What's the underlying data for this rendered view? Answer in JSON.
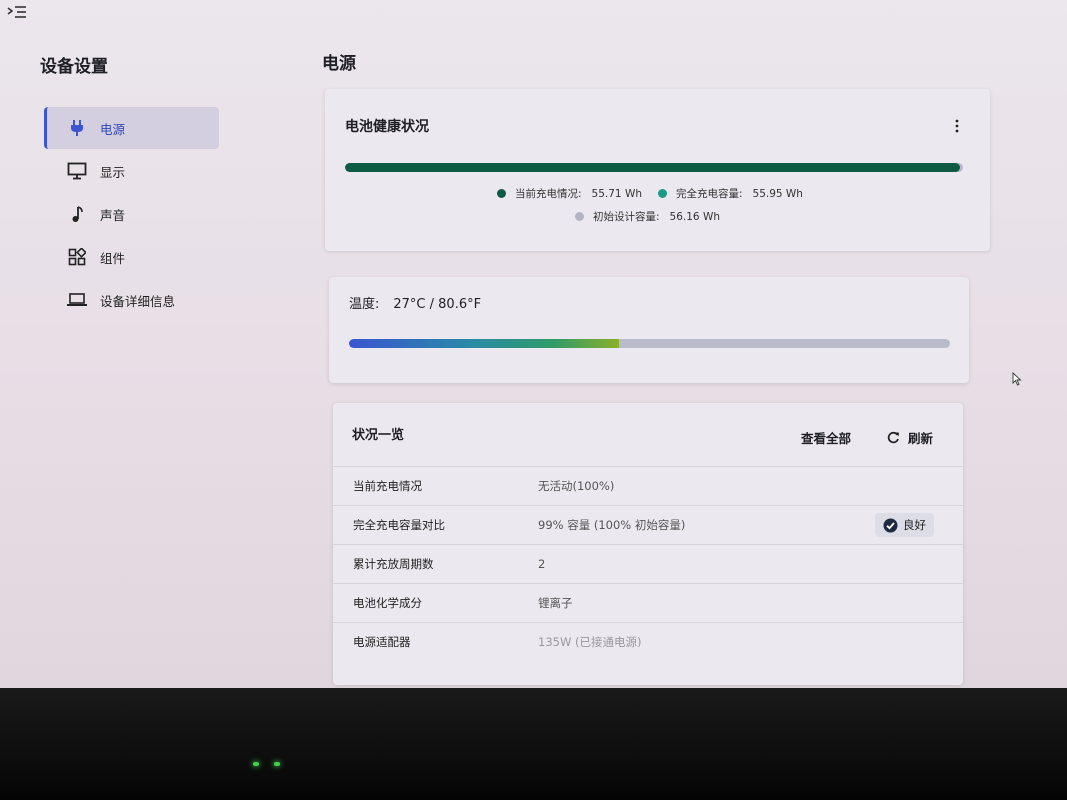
{
  "sidebar": {
    "title": "设备设置",
    "items": [
      {
        "label": "电源",
        "icon": "plug-icon",
        "active": true
      },
      {
        "label": "显示",
        "icon": "monitor-icon",
        "active": false
      },
      {
        "label": "声音",
        "icon": "music-note-icon",
        "active": false
      },
      {
        "label": "组件",
        "icon": "components-icon",
        "active": false
      },
      {
        "label": "设备详细信息",
        "icon": "laptop-icon",
        "active": false
      }
    ]
  },
  "main": {
    "title": "电源",
    "battery_health": {
      "title": "电池健康状况",
      "bar_fill_fraction": 0.995,
      "current_label": "当前充电情况:",
      "current_value": "55.71 Wh",
      "full_label": "完全充电容量:",
      "full_value": "55.95 Wh",
      "design_label": "初始设计容量:",
      "design_value": "56.16 Wh",
      "colors": {
        "current": "#0f5a44",
        "full": "#1b9a86",
        "design": "#b4b4c6"
      }
    },
    "temperature": {
      "label": "温度:",
      "value": "27°C / 80.6°F",
      "level_fraction": 0.45
    },
    "status": {
      "title": "状况一览",
      "view_all": "查看全部",
      "refresh": "刷新",
      "rows": [
        {
          "key": "当前充电情况",
          "value": "无活动(100%)",
          "badge": ""
        },
        {
          "key": "完全充电容量对比",
          "value": "99% 容量 (100% 初始容量)",
          "badge": "良好"
        },
        {
          "key": "累计充放周期数",
          "value": "2",
          "badge": ""
        },
        {
          "key": "电池化学成分",
          "value": "锂离子",
          "badge": ""
        },
        {
          "key": "电源适配器",
          "value": "135W (已接通电源)",
          "badge": ""
        }
      ]
    }
  },
  "accent_color": "#3b56d1"
}
